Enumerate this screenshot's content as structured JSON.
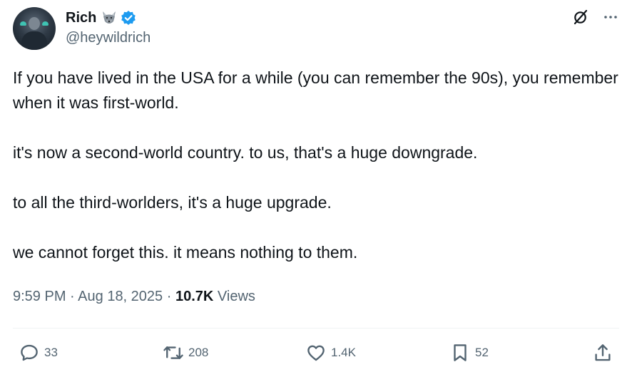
{
  "author": {
    "display_name": "Rich",
    "handle": "@heywildrich",
    "verified": true,
    "name_emoji": "wolf-face"
  },
  "tweet": {
    "paragraphs": [
      "If you have lived in the USA for a while (you can remember the 90s), you remember when it was first-world.",
      "it's now a second-world country. to us, that's a huge downgrade.",
      "to all the third-worlders, it's a huge upgrade.",
      "we cannot forget this. it means nothing to them."
    ],
    "time": "9:59 PM",
    "separator": "·",
    "date": "Aug 18, 2025",
    "views_count": "10.7K",
    "views_label": "Views"
  },
  "actions": {
    "reply_count": "33",
    "repost_count": "208",
    "like_count": "1.4K",
    "bookmark_count": "52"
  },
  "colors": {
    "text_primary": "#0f1419",
    "text_secondary": "#536471",
    "verified_blue": "#1d9bf0",
    "divider": "#eff3f4"
  },
  "icons": [
    "wolf-face-emoji",
    "verified-badge-icon",
    "grok-icon",
    "more-icon",
    "reply-icon",
    "repost-icon",
    "like-icon",
    "bookmark-icon",
    "share-icon"
  ]
}
